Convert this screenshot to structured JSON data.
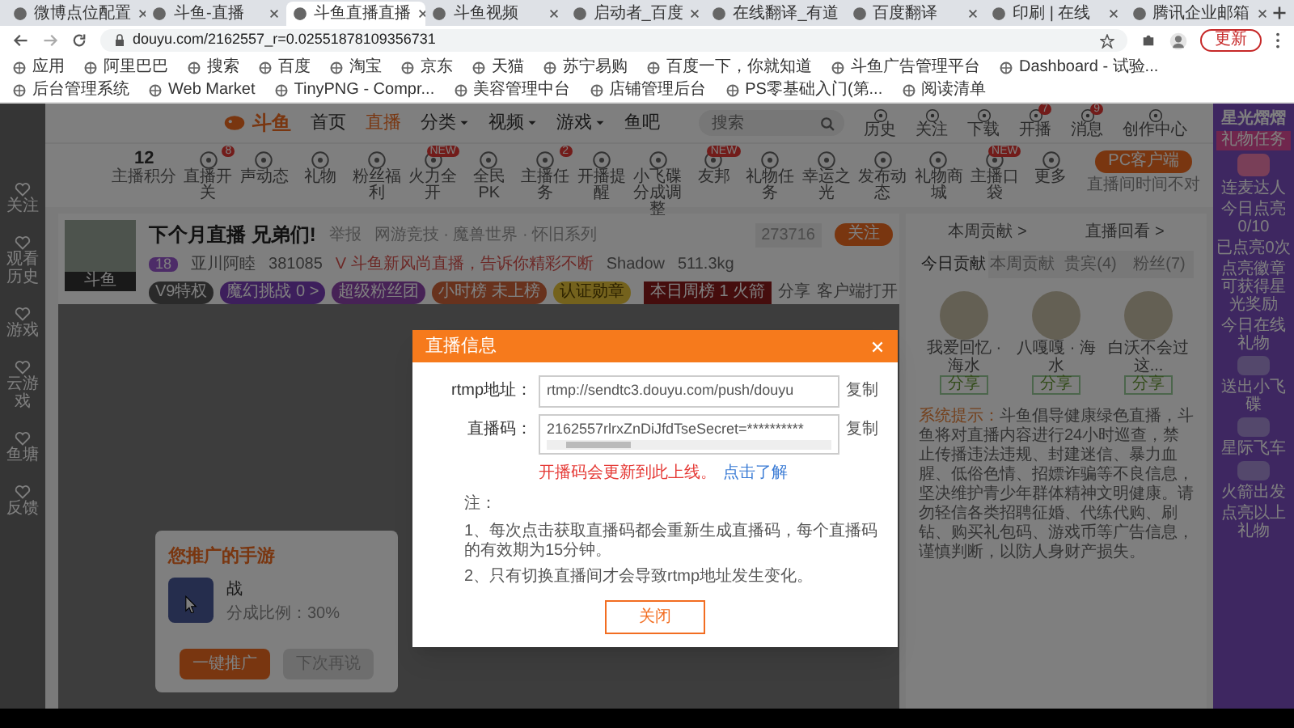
{
  "browser": {
    "tabs": [
      {
        "title": "微博点位配置",
        "selected": false
      },
      {
        "title": "斗鱼-直播",
        "selected": false
      },
      {
        "title": "斗鱼直播直播",
        "selected": true
      },
      {
        "title": "斗鱼视频",
        "selected": false
      },
      {
        "title": "启动者_百度",
        "selected": false
      },
      {
        "title": "在线翻译_有道",
        "selected": false
      },
      {
        "title": "百度翻译",
        "selected": false
      },
      {
        "title": "印刷 | 在线",
        "selected": false
      },
      {
        "title": "腾讯企业邮箱",
        "selected": false
      }
    ],
    "url": "douyu.com/2162557_r=0.02551878109356731",
    "update_button": "更新",
    "bookmarks": [
      "应用",
      "阿里巴巴",
      "搜索",
      "百度",
      "淘宝",
      "京东",
      "天猫",
      "苏宁易购",
      "百度一下，你就知道",
      "斗鱼广告管理平台",
      "Dashboard - 试验...",
      "后台管理系统",
      "Web Market",
      "TinyPNG - Compr...",
      "美容管理中台",
      "店铺管理后台",
      "PS零基础入门(第...",
      "阅读清单"
    ]
  },
  "sidebar": [
    {
      "label": "关注"
    },
    {
      "label": "观看历史"
    },
    {
      "label": "游戏"
    },
    {
      "label": "云游戏"
    },
    {
      "label": "鱼塘"
    },
    {
      "label": "反馈"
    }
  ],
  "site_nav": {
    "logo": "斗鱼",
    "links": [
      {
        "label": "首页",
        "selected": false,
        "has_menu": false
      },
      {
        "label": "直播",
        "selected": true,
        "has_menu": false
      },
      {
        "label": "分类",
        "selected": false,
        "has_menu": true
      },
      {
        "label": "视频",
        "selected": false,
        "has_menu": true
      },
      {
        "label": "游戏",
        "selected": false,
        "has_menu": true
      },
      {
        "label": "鱼吧",
        "selected": false,
        "has_menu": false
      }
    ],
    "search_placeholder": "搜索",
    "user_icons": [
      {
        "label": "历史"
      },
      {
        "label": "关注"
      },
      {
        "label": "下载"
      },
      {
        "label": "开播",
        "badge": "7"
      },
      {
        "label": "消息",
        "badge": "9"
      },
      {
        "label": "创作中心"
      }
    ]
  },
  "toolbar": {
    "points": "12",
    "points_label": "主播积分",
    "items": [
      {
        "label": "直播开关",
        "badge": "8"
      },
      {
        "label": "声动态"
      },
      {
        "label": "礼物"
      },
      {
        "label": "粉丝福利"
      },
      {
        "label": "火力全开",
        "badge": "NEW"
      },
      {
        "label": "全民PK"
      },
      {
        "label": "主播任务",
        "badge": "2"
      },
      {
        "label": "开播提醒"
      },
      {
        "label": "小飞碟分成调整"
      },
      {
        "label": "友邦",
        "badge": "NEW"
      },
      {
        "label": "礼物任务"
      },
      {
        "label": "幸运之光"
      },
      {
        "label": "发布动态"
      },
      {
        "label": "礼物商城"
      },
      {
        "label": "主播口袋",
        "badge": "NEW"
      },
      {
        "label": "更多"
      }
    ],
    "client_button": "PC客户端",
    "client_note": "直播间时间不对"
  },
  "streamer": {
    "title": "下个月直播 兄弟们!",
    "report": "举报",
    "category": "网游竞技 · 魔兽世界 · 怀旧系列",
    "avatar_caption": "斗鱼",
    "level": "18",
    "name": "亚川阿睦",
    "heat": "381085",
    "notice": "V 斗鱼新风尚直播，告诉你精彩不断",
    "uploader": "Shadow",
    "weight": "511.3kg",
    "chips": [
      {
        "label": "V9特权",
        "kind": "vip"
      },
      {
        "label": "魔幻挑战 0 >",
        "kind": "challenge"
      },
      {
        "label": "超级粉丝团",
        "kind": "fans"
      },
      {
        "label": "小时榜 未上榜",
        "kind": "rank"
      },
      {
        "label": "认证勋章",
        "kind": "medal"
      }
    ],
    "follower_count": "273716",
    "follow_button": "关注",
    "hot_rank": "本日周榜 1 火箭",
    "share": "分享",
    "client_open": "客户端打开"
  },
  "right_panel": {
    "links": [
      "本周贡献 >",
      "直播回看 >"
    ],
    "tabs": [
      {
        "label": "今日贡献",
        "selected": true
      },
      {
        "label": "本周贡献",
        "selected": false
      },
      {
        "label": "贵宾(4)",
        "selected": false
      },
      {
        "label": "粉丝(7)",
        "selected": false
      }
    ],
    "top_users": [
      {
        "name": "我爱回忆 · 海水",
        "tag": "分享"
      },
      {
        "name": "八嘎嘎 · 海水",
        "tag": "分享"
      },
      {
        "name": "白沃不会过这...",
        "tag": "分享"
      }
    ],
    "system_label": "系统提示：",
    "system_text": "斗鱼倡导健康绿色直播，斗鱼将对直播内容进行24小时巡查，禁止传播违法违规、封建迷信、暴力血腥、低俗色情、招嫖诈骗等不良信息，坚决维护青少年群体精神文明健康。请勿轻信各类招聘征婚、代练代购、刷钻、购买礼包码、游戏币等广告信息，谨慎判断，以防人身财产损失。"
  },
  "event_banner": {
    "title": "星光熠熠",
    "section_1": "礼物任务",
    "gift_1": "连麦达人",
    "progress_1": "今日点亮0/10",
    "progress_2": "已点亮0次",
    "reward": "点亮徽章可获得星光奖励",
    "section_2": "今日在线礼物",
    "items": [
      "送出小飞碟",
      "星际飞车",
      "火箭出发"
    ],
    "footer": "点亮以上礼物"
  },
  "promo_popup": {
    "title": "您推广的手游",
    "game_name": "战",
    "share_ratio": "分成比例：30%",
    "primary_button": "一键推广",
    "secondary_button": "下次再说"
  },
  "dialog": {
    "title": "直播信息",
    "rtmp_label": "rtmp地址：",
    "rtmp_value": "rtmp://sendtc3.douyu.com/push/douyu",
    "code_label": "直播码：",
    "code_value": "2162557rlrxZnDiJfdTseSecret=**********",
    "copy_links": [
      "复制",
      "复制"
    ],
    "warning": "开播码会更新到此上线。",
    "learn_more": "点击了解",
    "notes_title": "注：",
    "notes": [
      "1、每次点击获取直播码都会重新生成直播码，每个直播码的有效期为15分钟。",
      "2、只有切换直播间才会导致rtmp地址发生变化。"
    ],
    "close_button": "关闭"
  }
}
